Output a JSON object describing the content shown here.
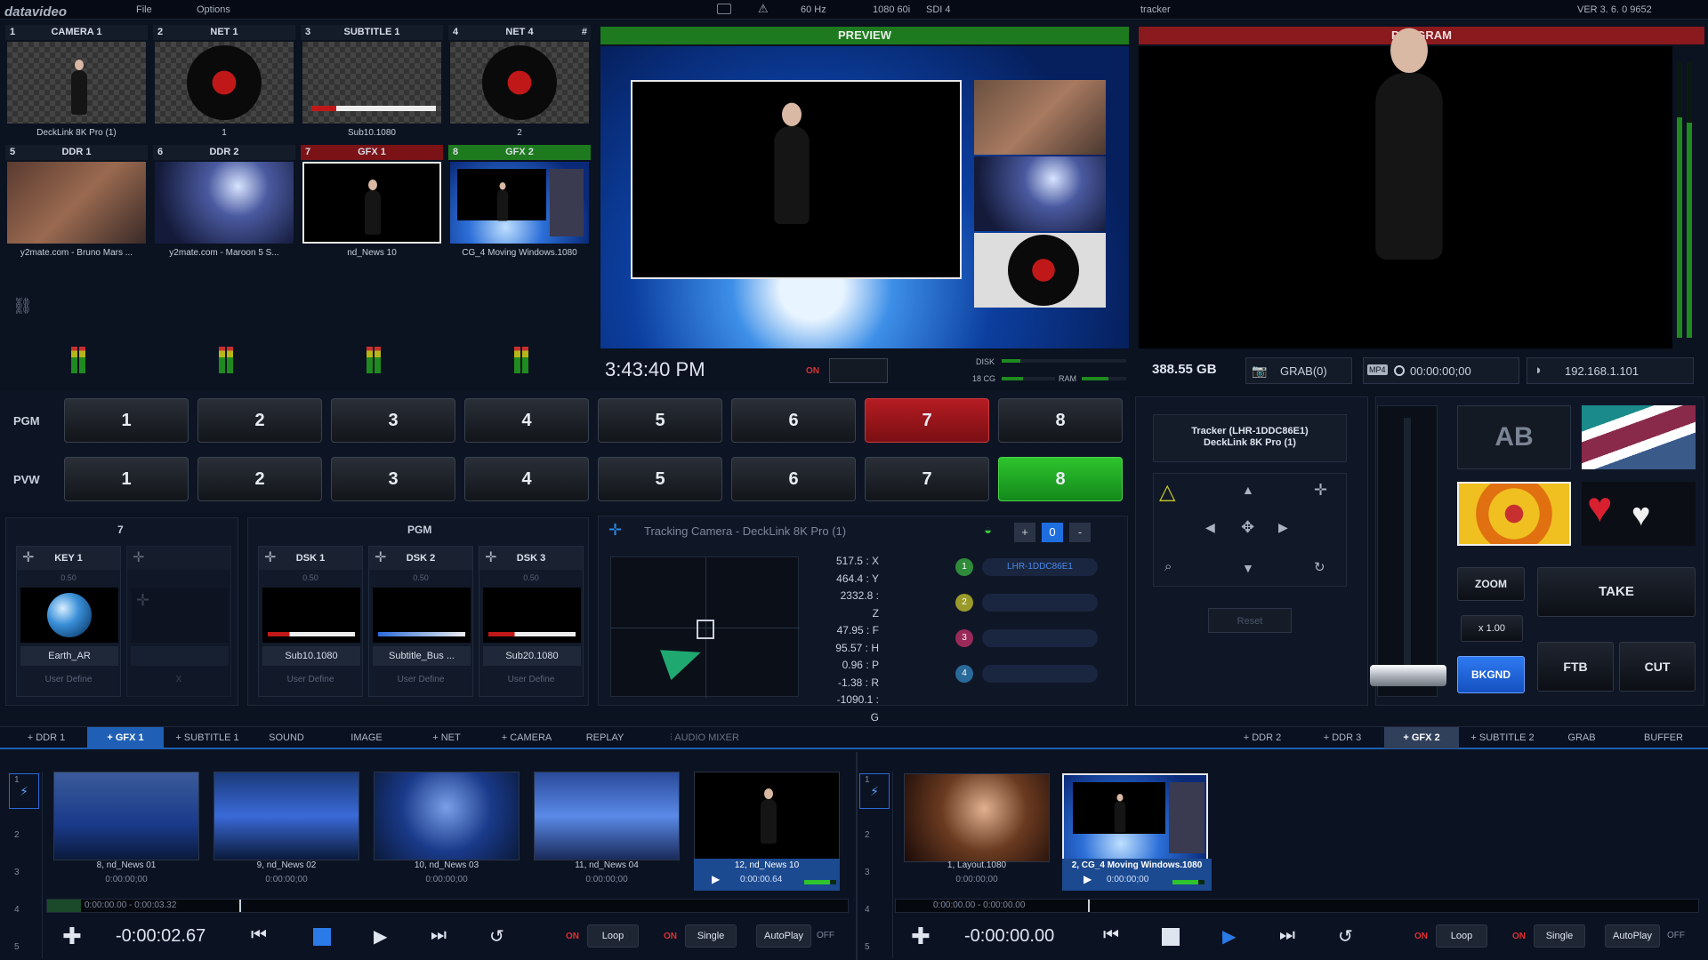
{
  "app": {
    "logo": "datavideo",
    "menu": [
      "File",
      "Options"
    ],
    "status": {
      "hz": "60 Hz",
      "format": "1080 60i",
      "sdi": "SDI 4",
      "tracker": "tracker",
      "version": "VER 3. 6. 0 9652"
    }
  },
  "sources": [
    {
      "num": "1",
      "name": "CAMERA 1",
      "caption": "DeckLink 8K Pro (1)",
      "state": "normal"
    },
    {
      "num": "2",
      "name": "NET 1",
      "caption": "1",
      "state": "normal"
    },
    {
      "num": "3",
      "name": "SUBTITLE 1",
      "caption": "Sub10.1080",
      "state": "normal"
    },
    {
      "num": "4",
      "name": "NET 4",
      "caption": "2",
      "state": "normal",
      "extra": "#"
    },
    {
      "num": "5",
      "name": "DDR 1",
      "caption": "y2mate.com - Bruno Mars ...",
      "state": "normal"
    },
    {
      "num": "6",
      "name": "DDR 2",
      "caption": "y2mate.com - Maroon 5  S...",
      "state": "normal"
    },
    {
      "num": "7",
      "name": "GFX 1",
      "caption": "nd_News 10",
      "state": "program"
    },
    {
      "num": "8",
      "name": "GFX 2",
      "caption": "CG_4 Moving Windows.1080",
      "state": "preview"
    }
  ],
  "preview": {
    "label": "PREVIEW"
  },
  "program": {
    "label": "PROGRAM"
  },
  "status_row": {
    "clock": "3:43:40 PM",
    "on": "ON",
    "disk_label": "DISK",
    "cg_label": "18 CG",
    "ram_label": "RAM",
    "disk_free": "388.55 GB",
    "grab": "GRAB(0)",
    "rec_format": "MP4",
    "rec_time": "00:00:00;00",
    "ip": "192.168.1.101"
  },
  "buses": {
    "pgm_label": "PGM",
    "pvw_label": "PVW",
    "buttons": [
      "1",
      "2",
      "3",
      "4",
      "5",
      "6",
      "7",
      "8"
    ],
    "pgm_active": "7",
    "pvw_active": "8"
  },
  "keyers": {
    "key_header": "7",
    "pgm_header": "PGM",
    "items": [
      {
        "name": "KEY 1",
        "value": "0.50",
        "source": "Earth_AR",
        "footer": "User Define"
      },
      {
        "name": "",
        "value": "",
        "source": "",
        "footer": "X"
      },
      {
        "name": "DSK 1",
        "value": "0.50",
        "source": "Sub10.1080",
        "footer": "User Define"
      },
      {
        "name": "DSK 2",
        "value": "0.50",
        "source": "Subtitle_Bus ...",
        "footer": "User Define"
      },
      {
        "name": "DSK 3",
        "value": "0.50",
        "source": "Sub20.1080",
        "footer": "User Define"
      }
    ]
  },
  "tracking": {
    "title": "Tracking Camera - DeckLink 8K Pro (1)",
    "counter": "0",
    "values": [
      "517.5 : X",
      "464.4 : Y",
      "2332.8 : Z",
      "47.95 : F",
      "95.57 : H",
      "0.96 : P",
      "-1.38 : R",
      "-1090.1 : G"
    ],
    "trackers": [
      {
        "num": "1",
        "label": "LHR-1DDC86E1",
        "color": "#2f8a3a"
      },
      {
        "num": "2",
        "label": "",
        "color": "#9a9a2a"
      },
      {
        "num": "3",
        "label": "",
        "color": "#9a2a5a"
      },
      {
        "num": "4",
        "label": "",
        "color": "#2a6a9a"
      }
    ]
  },
  "tracker_panel": {
    "name": "Tracker (LHR-1DDC86E1)",
    "device": "DeckLink 8K Pro (1)",
    "reset": "Reset"
  },
  "transition": {
    "ab": "AB",
    "zoom": "ZOOM",
    "zoom_value": "x 1.00",
    "take": "TAKE",
    "bkgnd": "BKGND",
    "ftb": "FTB",
    "cut": "CUT"
  },
  "tabs_left": [
    "+ DDR 1",
    "+ GFX 1",
    "+ SUBTITLE 1",
    "SOUND",
    "IMAGE",
    "+ NET",
    "+ CAMERA",
    "REPLAY",
    "AUDIO MIXER"
  ],
  "tabs_left_active": "+ GFX 1",
  "tabs_right": [
    "+ DDR 2",
    "+ DDR 3",
    "+ GFX 2",
    "+ SUBTITLE 2",
    "GRAB",
    "BUFFER"
  ],
  "tabs_right_active": "+ GFX 2",
  "left_player": {
    "clips": [
      {
        "name": "8, nd_News 01",
        "time": "0:00:00;00"
      },
      {
        "name": "9, nd_News 02",
        "time": "0:00:00;00"
      },
      {
        "name": "10, nd_News 03",
        "time": "0:00:00;00"
      },
      {
        "name": "11, nd_News 04",
        "time": "0:00:00;00"
      },
      {
        "name": "12, nd_News 10",
        "time": "0:00:00.64"
      }
    ],
    "range": "0:00:00.00 - 0:00:03.32",
    "counter": "-0:00:02.67",
    "on1": "ON",
    "loop": "Loop",
    "on2": "ON",
    "single": "Single",
    "autoplay": "AutoPlay",
    "off": "OFF",
    "rows": [
      "1",
      "2",
      "3",
      "4",
      "5"
    ]
  },
  "right_player": {
    "clips": [
      {
        "name": "1, Layout.1080",
        "time": "0:00:00;00"
      },
      {
        "name": "2, CG_4 Moving Windows.1080",
        "time": "0:00:00;00"
      }
    ],
    "range": "0:00:00.00 - 0:00:00.00",
    "counter": "-0:00:00.00",
    "on1": "ON",
    "loop": "Loop",
    "on2": "ON",
    "single": "Single",
    "autoplay": "AutoPlay",
    "off": "OFF",
    "rows": [
      "1",
      "2",
      "3",
      "4",
      "5"
    ]
  }
}
